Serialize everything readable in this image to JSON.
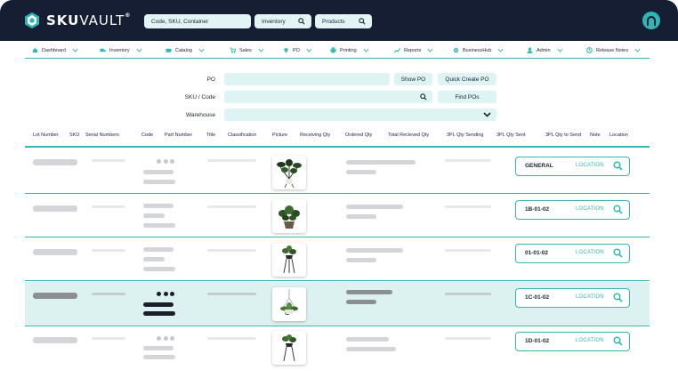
{
  "app": {
    "brand_bold": "SKU",
    "brand_light": "VAULT",
    "trademark": "®"
  },
  "top_search": {
    "code_placeholder": "Code, SKU, Container",
    "inventory_label": "Inventory",
    "products_label": "Products"
  },
  "nav": {
    "items": [
      {
        "label": "Dashboard",
        "icon": "home-icon"
      },
      {
        "label": "Inventory",
        "icon": "truck-icon"
      },
      {
        "label": "Catalog",
        "icon": "catalog-icon"
      },
      {
        "label": "Sales",
        "icon": "cart-icon"
      },
      {
        "label": "PO",
        "icon": "po-icon"
      },
      {
        "label": "Printing",
        "icon": "printer-icon"
      },
      {
        "label": "Reports",
        "icon": "reports-icon"
      },
      {
        "label": "BusinessHub",
        "icon": "gear-icon"
      },
      {
        "label": "Admin",
        "icon": "admin-icon"
      },
      {
        "label": "Release Notes",
        "icon": "notes-icon"
      }
    ]
  },
  "form": {
    "po_label": "PO",
    "sku_label": "SKU / Code",
    "warehouse_label": "Warehouse",
    "show_po": "Show PO",
    "quick_create_po": "Quick Create PO",
    "find_pos": "Find POs"
  },
  "table": {
    "columns": [
      "Lot Number",
      "SKU",
      "Serial Numbers",
      "Code",
      "Part Number",
      "Title",
      "Classification",
      "Picture",
      "Receiving Qty",
      "Ordered Qty",
      "Total Recieved Qty",
      "3PL Qty Sending",
      "3PL Qty Sent",
      "3PL Qty to Send",
      "Note",
      "Location"
    ],
    "rows": [
      {
        "location_code": "GENERAL",
        "location_label": "LOCATION"
      },
      {
        "location_code": "1B-01-02",
        "location_label": "LOCATION"
      },
      {
        "location_code": "01-01-02",
        "location_label": "LOCATION"
      },
      {
        "location_code": "1C-01-02",
        "location_label": "LOCATION",
        "selected": true
      },
      {
        "location_code": "1D-01-02",
        "location_label": "LOCATION"
      }
    ]
  },
  "colors": {
    "topbar": "#161e33",
    "accent": "#34b8b3",
    "field": "#ddf4f3",
    "selected_row": "#dcf2f1"
  }
}
